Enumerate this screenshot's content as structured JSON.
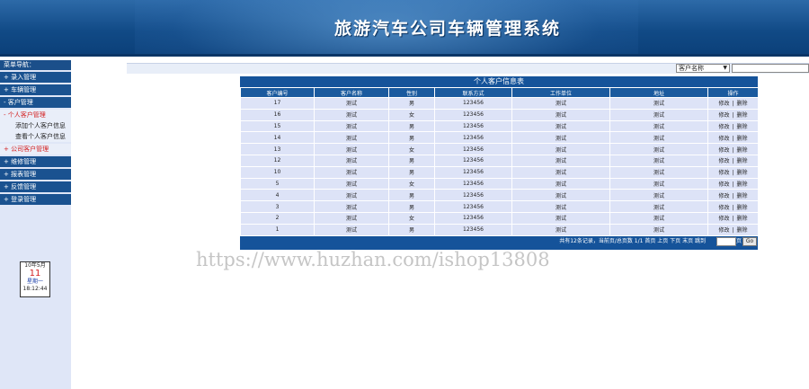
{
  "header": {
    "title": "旅游汽车公司车辆管理系统"
  },
  "sidebar": {
    "heading": "菜单导航：",
    "items": [
      {
        "label": "+ 录入管理"
      },
      {
        "label": "+ 车辆管理"
      },
      {
        "label": "- 客户管理"
      },
      {
        "label": "- 个人客户管理"
      },
      {
        "label": "+ 公司客户管理"
      },
      {
        "label": "+ 维修管理"
      },
      {
        "label": "+ 报表管理"
      },
      {
        "label": "+ 反馈管理"
      },
      {
        "label": "+ 登录管理"
      }
    ],
    "subitems": [
      {
        "label": "添加个人客户信息"
      },
      {
        "label": "查看个人客户信息"
      }
    ]
  },
  "calendar": {
    "month": "10年5月",
    "day": "11",
    "weekday": "星期一",
    "time": "18:12:44"
  },
  "search": {
    "select_label": "客户名称",
    "input_value": ""
  },
  "table": {
    "title": "个人客户信息表",
    "columns": [
      "客户编号",
      "客户名称",
      "性别",
      "联系方式",
      "工作单位",
      "地址",
      "操作"
    ],
    "rows": [
      [
        "17",
        "测试",
        "男",
        "123456",
        "测试",
        "测试"
      ],
      [
        "16",
        "测试",
        "女",
        "123456",
        "测试",
        "测试"
      ],
      [
        "15",
        "测试",
        "男",
        "123456",
        "测试",
        "测试"
      ],
      [
        "14",
        "测试",
        "男",
        "123456",
        "测试",
        "测试"
      ],
      [
        "13",
        "测试",
        "女",
        "123456",
        "测试",
        "测试"
      ],
      [
        "12",
        "测试",
        "男",
        "123456",
        "测试",
        "测试"
      ],
      [
        "10",
        "测试",
        "男",
        "123456",
        "测试",
        "测试"
      ],
      [
        "5",
        "测试",
        "女",
        "123456",
        "测试",
        "测试"
      ],
      [
        "4",
        "测试",
        "男",
        "123456",
        "测试",
        "测试"
      ],
      [
        "3",
        "测试",
        "男",
        "123456",
        "测试",
        "测试"
      ],
      [
        "2",
        "测试",
        "女",
        "123456",
        "测试",
        "测试"
      ],
      [
        "1",
        "测试",
        "男",
        "123456",
        "测试",
        "测试"
      ]
    ],
    "edit_label": "修改",
    "sep": "|",
    "delete_label": "删除",
    "footer_info": "共有12条记录，当前页/总页数 1/1 首页  上页  下页  末页 跳到",
    "page_unit": "页",
    "go_label": "Go"
  },
  "watermark": "https://www.huzhan.com/ishop13808"
}
